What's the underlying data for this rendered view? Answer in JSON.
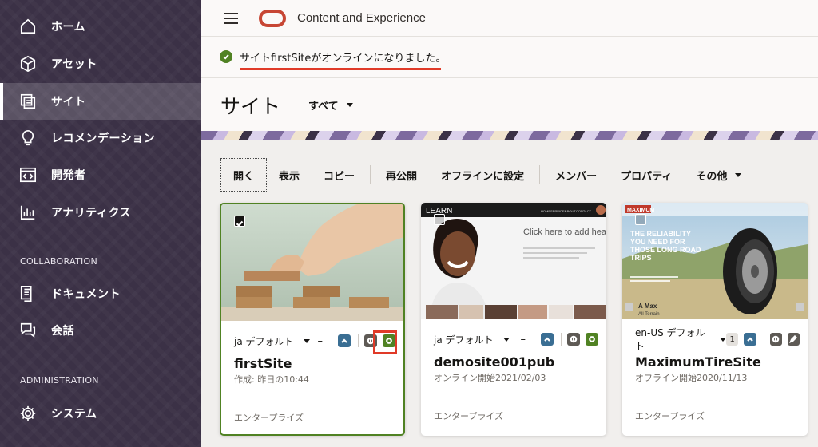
{
  "header": {
    "app_title": "Content and Experience"
  },
  "notification": {
    "text": "サイトfirstSiteがオンラインになりました。"
  },
  "sidebar": {
    "items": [
      {
        "label": "ホーム",
        "icon": "home-icon"
      },
      {
        "label": "アセット",
        "icon": "cube-icon"
      },
      {
        "label": "サイト",
        "icon": "sites-icon"
      },
      {
        "label": "レコメンデーション",
        "icon": "lightbulb-icon"
      },
      {
        "label": "開発者",
        "icon": "code-icon"
      },
      {
        "label": "アナリティクス",
        "icon": "chart-icon"
      }
    ],
    "collaboration_label": "COLLABORATION",
    "collab_items": [
      {
        "label": "ドキュメント",
        "icon": "document-icon"
      },
      {
        "label": "会話",
        "icon": "conversation-icon"
      }
    ],
    "administration_label": "ADMINISTRATION",
    "admin_items": [
      {
        "label": "システム",
        "icon": "gear-icon"
      }
    ]
  },
  "page": {
    "title": "サイト",
    "filter": "すべて"
  },
  "toolbar": {
    "open": "開く",
    "view": "表示",
    "copy": "コピー",
    "republish": "再公開",
    "offline": "オフラインに設定",
    "members": "メンバー",
    "properties": "プロパティ",
    "more": "その他"
  },
  "cards": [
    {
      "name": "firstSite",
      "locale": "ja デフォルト",
      "subtitle": "作成: 昨日の10:44",
      "type": "エンタープライズ",
      "status": "online"
    },
    {
      "name": "demosite001pub",
      "locale": "ja デフォルト",
      "subtitle": "オンライン開始2021/02/03",
      "type": "エンタープライズ",
      "status": "online"
    },
    {
      "name": "MaximumTireSite",
      "locale": "en-US デフォルト",
      "subtitle": "オフライン開始2020/11/13",
      "type": "エンタープライズ",
      "status": "offline",
      "count": "1"
    }
  ],
  "card_placeholder": {
    "dash": "–"
  },
  "thumbs": {
    "demo_brand": "LEARN",
    "demo_headline": "Click here to add headline",
    "demo_nav": [
      "HOME",
      "SERVICES",
      "ABOUT",
      "CONTACT"
    ],
    "tire_brand": "MAXIMUM",
    "tire_headline": "THE RELIABILITY YOU NEED FOR THOSE LONG ROAD TRIPS",
    "tire_product": "A Max",
    "tire_product_sub": "All Terrain"
  },
  "colors": {
    "sidebar_bg": "#3b3146",
    "accent_green": "#508223",
    "oracle_red": "#c74634",
    "annotation_red": "#e03a28",
    "blue_button": "#3a6e93"
  }
}
